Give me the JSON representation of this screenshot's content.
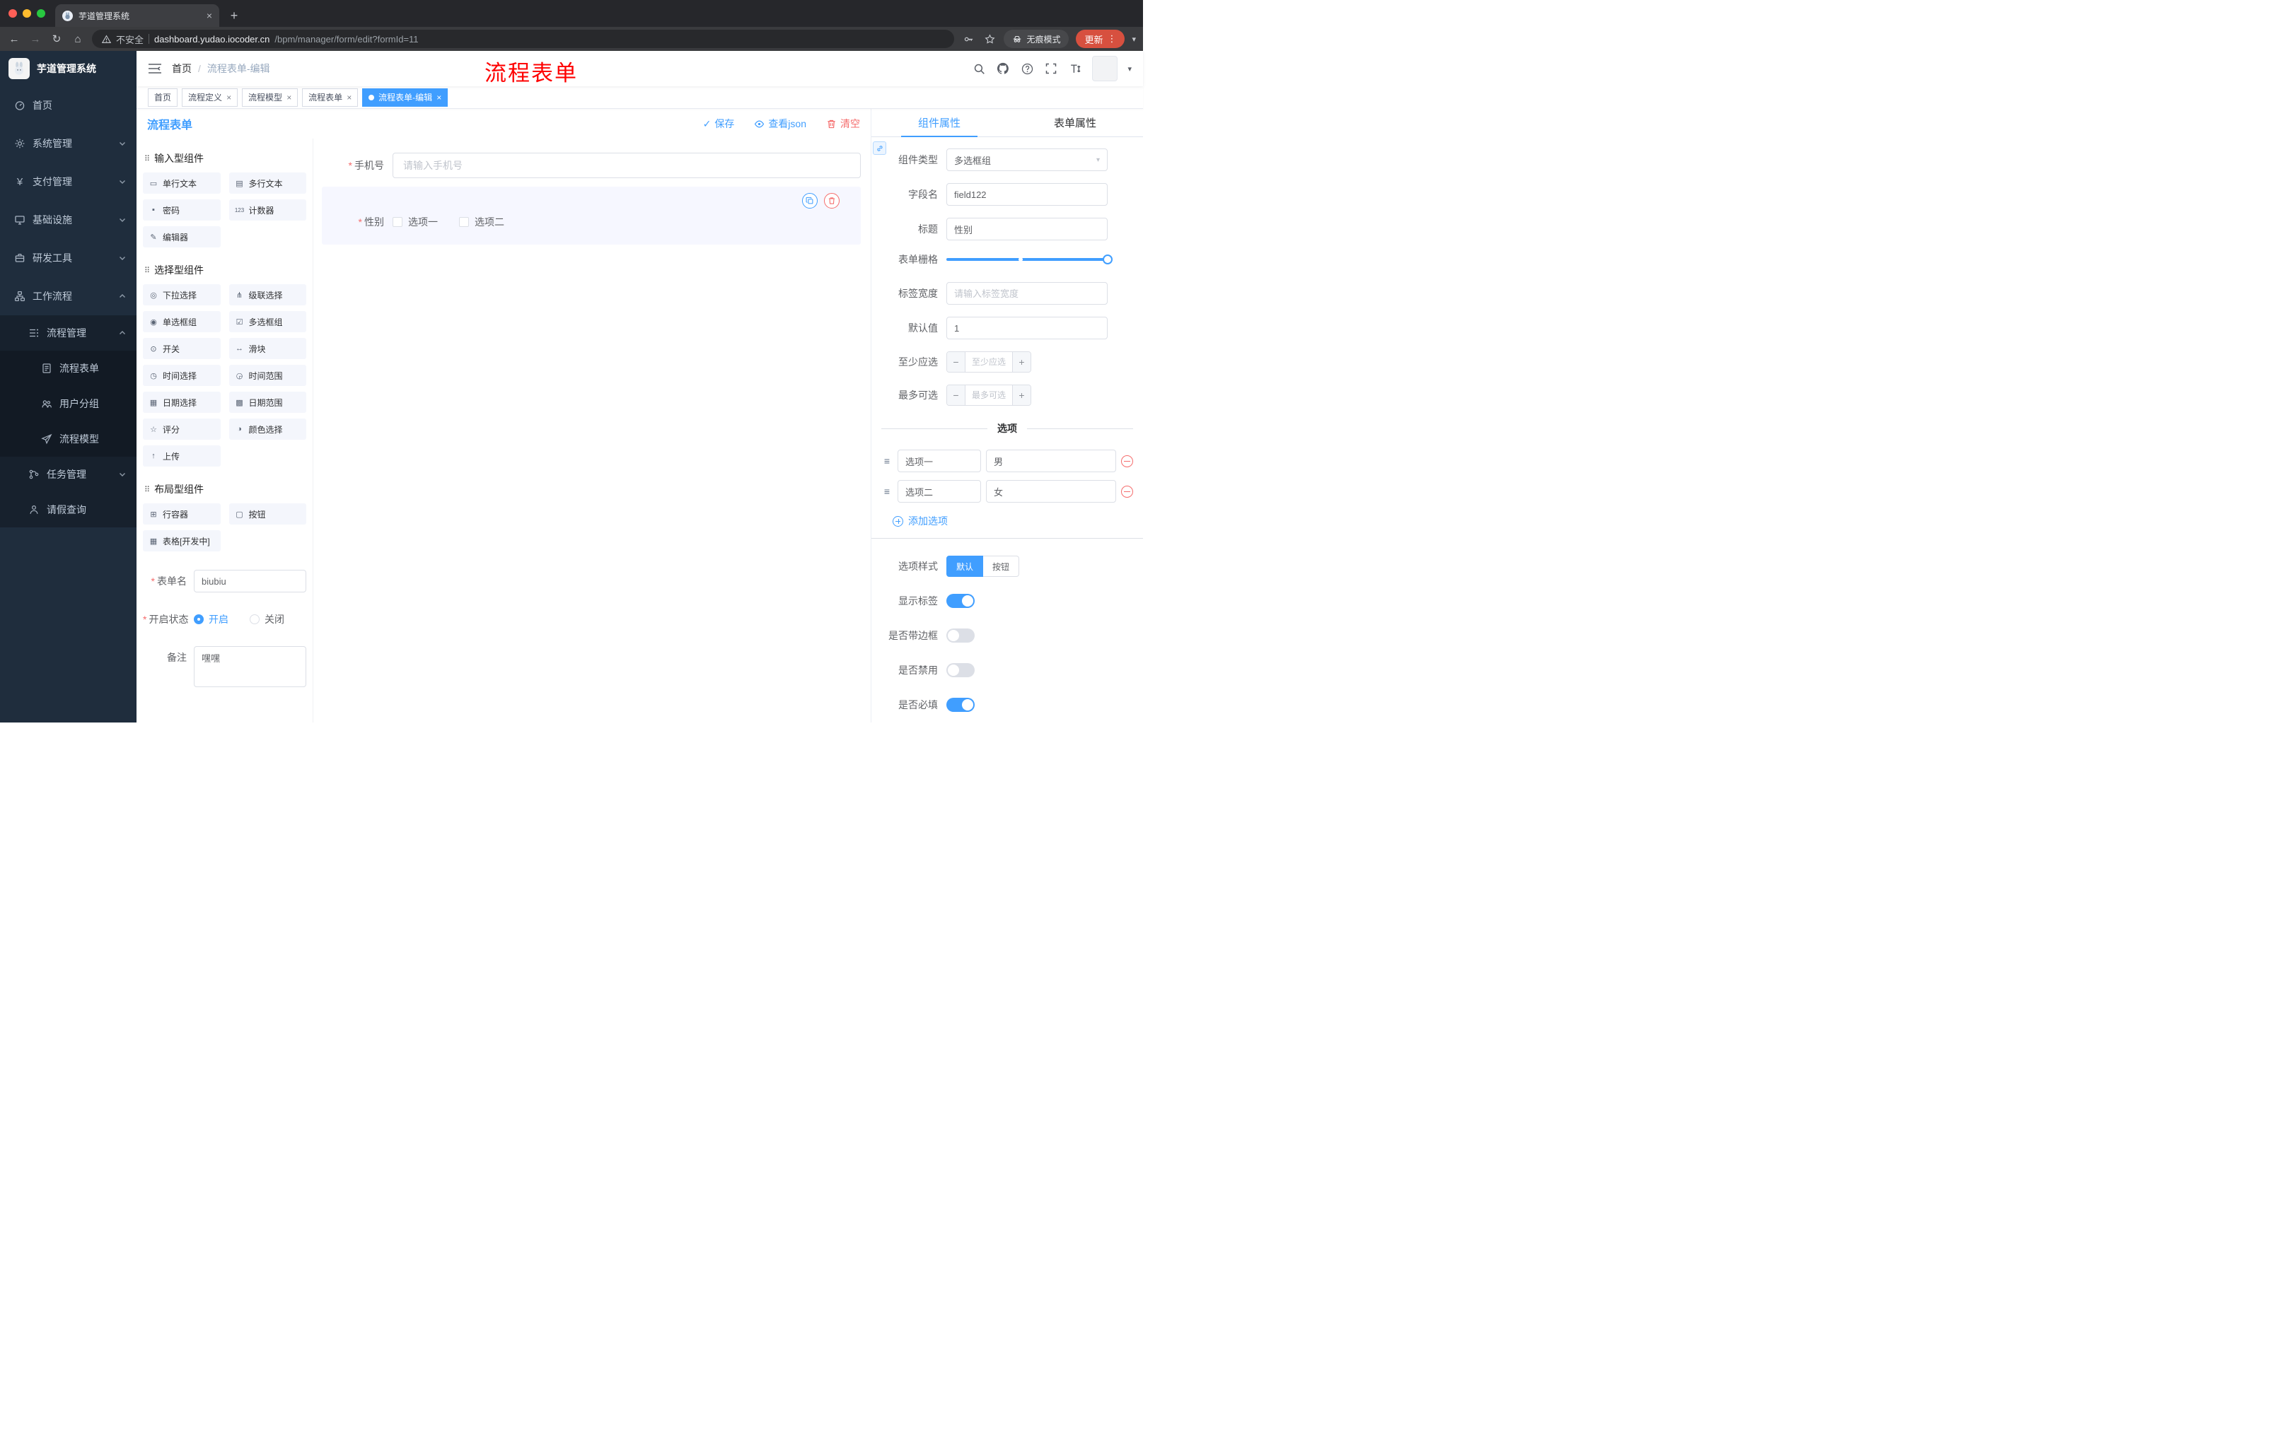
{
  "browser": {
    "tab_title": "芋道管理系统",
    "security_label": "不安全",
    "url_domain": "dashboard.yudao.iocoder.cn",
    "url_path": "/bpm/manager/form/edit?formId=11",
    "incognito_label": "无痕模式",
    "update_label": "更新"
  },
  "header": {
    "breadcrumb_home": "首页",
    "breadcrumb_current": "流程表单-编辑",
    "annotation": "流程表单"
  },
  "sidebar": {
    "logo_title": "芋道管理系统",
    "items": [
      {
        "label": "首页"
      },
      {
        "label": "系统管理"
      },
      {
        "label": "支付管理"
      },
      {
        "label": "基础设施"
      },
      {
        "label": "研发工具"
      },
      {
        "label": "工作流程"
      },
      {
        "label": "流程管理"
      },
      {
        "label": "流程表单"
      },
      {
        "label": "用户分组"
      },
      {
        "label": "流程模型"
      },
      {
        "label": "任务管理"
      },
      {
        "label": "请假查询"
      }
    ]
  },
  "tags": {
    "items": [
      {
        "label": "首页"
      },
      {
        "label": "流程定义"
      },
      {
        "label": "流程模型"
      },
      {
        "label": "流程表单"
      },
      {
        "label": "流程表单-编辑"
      }
    ]
  },
  "designer": {
    "title": "流程表单",
    "save_label": "保存",
    "view_json_label": "查看json",
    "clear_label": "清空",
    "palette": {
      "sections": [
        {
          "title": "输入型组件",
          "items": [
            {
              "label": "单行文本",
              "icon": "single-line-text-icon",
              "glyph": "▭"
            },
            {
              "label": "多行文本",
              "icon": "textarea-icon",
              "glyph": "▤"
            },
            {
              "label": "密码",
              "icon": "password-icon",
              "glyph": "▪"
            },
            {
              "label": "计数器",
              "icon": "counter-icon",
              "glyph": "123"
            },
            {
              "label": "编辑器",
              "icon": "editor-icon",
              "glyph": "✎"
            }
          ]
        },
        {
          "title": "选择型组件",
          "items": [
            {
              "label": "下拉选择",
              "icon": "select-icon",
              "glyph": "◎"
            },
            {
              "label": "级联选择",
              "icon": "cascader-icon",
              "glyph": "⋔"
            },
            {
              "label": "单选框组",
              "icon": "radio-group-icon",
              "glyph": "◉"
            },
            {
              "label": "多选框组",
              "icon": "checkbox-group-icon",
              "glyph": "☑"
            },
            {
              "label": "开关",
              "icon": "switch-icon",
              "glyph": "⊙"
            },
            {
              "label": "滑块",
              "icon": "slider-icon",
              "glyph": "↔"
            },
            {
              "label": "时间选择",
              "icon": "time-picker-icon",
              "glyph": "◷"
            },
            {
              "label": "时间范围",
              "icon": "time-range-icon",
              "glyph": "◶"
            },
            {
              "label": "日期选择",
              "icon": "date-picker-icon",
              "glyph": "▦"
            },
            {
              "label": "日期范围",
              "icon": "date-range-icon",
              "glyph": "▩"
            },
            {
              "label": "评分",
              "icon": "rate-icon",
              "glyph": "☆"
            },
            {
              "label": "颜色选择",
              "icon": "color-picker-icon",
              "glyph": "◑"
            },
            {
              "label": "上传",
              "icon": "upload-icon",
              "glyph": "↑"
            }
          ]
        },
        {
          "title": "布局型组件",
          "items": [
            {
              "label": "行容器",
              "icon": "row-container-icon",
              "glyph": "⊞"
            },
            {
              "label": "按钮",
              "icon": "button-icon",
              "glyph": "▢"
            },
            {
              "label": "表格[开发中]",
              "icon": "table-icon",
              "glyph": "▦"
            }
          ]
        }
      ]
    },
    "meta": {
      "form_name_label": "表单名",
      "form_name_value": "biubiu",
      "status_label": "开启状态",
      "status_on": "开启",
      "status_off": "关闭",
      "remark_label": "备注",
      "remark_value": "嘿嘿"
    },
    "canvas": {
      "phone_label": "手机号",
      "phone_placeholder": "请输入手机号",
      "gender_label": "性别",
      "gender_options": [
        {
          "label": "选项一"
        },
        {
          "label": "选项二"
        }
      ]
    }
  },
  "props": {
    "tab_component": "组件属性",
    "tab_form": "表单属性",
    "component_type_label": "组件类型",
    "component_type_value": "多选框组",
    "field_name_label": "字段名",
    "field_name_value": "field122",
    "title_label": "标题",
    "title_value": "性别",
    "grid_label": "表单栅格",
    "label_width_label": "标签宽度",
    "label_width_placeholder": "请输入标签宽度",
    "default_label": "默认值",
    "default_value": "1",
    "min_label": "至少应选",
    "min_placeholder": "至少应选",
    "max_label": "最多可选",
    "max_placeholder": "最多可选",
    "options_title": "选项",
    "options": [
      {
        "label": "选项一",
        "value": "男"
      },
      {
        "label": "选项二",
        "value": "女"
      }
    ],
    "add_option_label": "添加选项",
    "style_label": "选项样式",
    "style_default": "默认",
    "style_button": "按钮",
    "switch_show_label": "显示标签",
    "switch_border_label": "是否带边框",
    "switch_disabled_label": "是否禁用",
    "switch_required_label": "是否必填"
  },
  "colors": {
    "primary": "#409eff",
    "danger": "#f56c6c",
    "annotation": "#fe0000"
  }
}
